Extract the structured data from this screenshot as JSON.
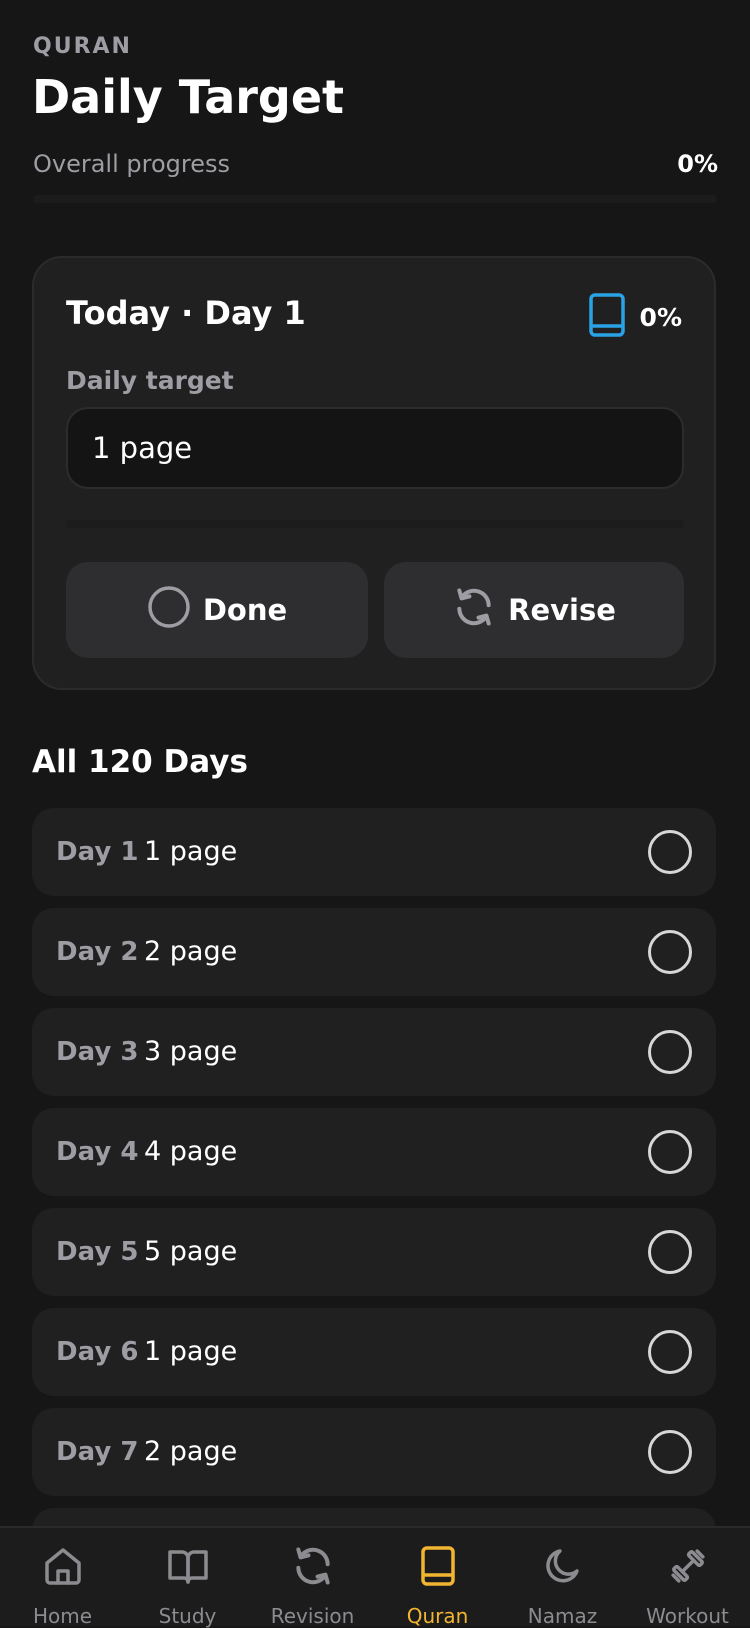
{
  "header": {
    "eyebrow": "QURAN",
    "title": "Daily Target",
    "overall_label": "Overall progress",
    "overall_value": "0%",
    "overall_progress": 0
  },
  "today": {
    "title": "Today · Day 1",
    "percent": "0%",
    "progress": 0,
    "icon": "book-icon",
    "target_label": "Daily target",
    "target_value": "1 page",
    "done_label": "Done",
    "revise_label": "Revise"
  },
  "days": {
    "title": "All 120 Days",
    "items": [
      {
        "label": "Day 1",
        "target": "1 page",
        "done": false
      },
      {
        "label": "Day 2",
        "target": "2 page",
        "done": false
      },
      {
        "label": "Day 3",
        "target": "3 page",
        "done": false
      },
      {
        "label": "Day 4",
        "target": "4 page",
        "done": false
      },
      {
        "label": "Day 5",
        "target": "5 page",
        "done": false
      },
      {
        "label": "Day 6",
        "target": "1 page",
        "done": false
      },
      {
        "label": "Day 7",
        "target": "2 page",
        "done": false
      }
    ]
  },
  "tabs": [
    {
      "label": "Home",
      "icon": "home-icon",
      "active": false
    },
    {
      "label": "Study",
      "icon": "open-book-icon",
      "active": false
    },
    {
      "label": "Revision",
      "icon": "refresh-icon",
      "active": false
    },
    {
      "label": "Quran",
      "icon": "book-icon",
      "active": true
    },
    {
      "label": "Namaz",
      "icon": "moon-icon",
      "active": false
    },
    {
      "label": "Workout",
      "icon": "dumbbell-icon",
      "active": false
    }
  ],
  "colors": {
    "background": "#161616",
    "card": "#202021",
    "accent": "#f2b531",
    "book_blue": "#2aa3e6",
    "muted": "#9d9da3"
  }
}
